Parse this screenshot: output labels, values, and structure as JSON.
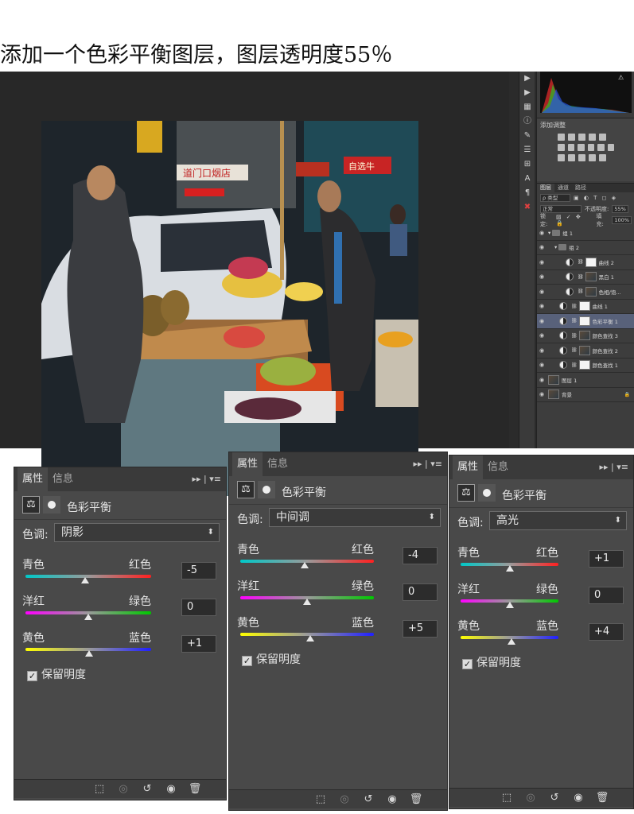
{
  "caption": "添加一个色彩平衡图层，图层透明度55％",
  "toolbar": {
    "buttons": [
      "triangle-right-icon",
      "play-icon",
      "swatch-icon",
      "info-icon",
      "brush-icon",
      "sliders-icon",
      "type-icon",
      "paragraph-icon",
      "close-icon"
    ]
  },
  "photo": {
    "signs": [
      "自选牛",
      "道门口烟店"
    ]
  },
  "adjustments_panel": {
    "label": "添加调整"
  },
  "layers_panel": {
    "tabs": [
      "图层",
      "通道",
      "路径"
    ],
    "kind_filter": "ρ 类型",
    "blend_mode": "正常",
    "opacity_label": "不透明度:",
    "opacity_value": "55%",
    "lock_label": "锁定:",
    "fill_label": "填充:",
    "fill_value": "100%",
    "layers": [
      {
        "name": "组 1",
        "type": "group"
      },
      {
        "name": "组 2",
        "type": "group"
      },
      {
        "name": "曲线 2",
        "type": "adj-white"
      },
      {
        "name": "黑白 1",
        "type": "adj-img"
      },
      {
        "name": "色相/饱... ",
        "type": "adj-img"
      },
      {
        "name": "曲线 1",
        "type": "adj-white"
      },
      {
        "name": "色彩平衡 1",
        "type": "adj-white",
        "selected": true
      },
      {
        "name": "颜色查找 3",
        "type": "adj-img"
      },
      {
        "name": "颜色查找 2",
        "type": "adj-img"
      },
      {
        "name": "颜色查找 1",
        "type": "adj-white"
      },
      {
        "name": "图层 1",
        "type": "pixel"
      },
      {
        "name": "背景",
        "type": "pixel"
      }
    ]
  },
  "properties_panels": [
    {
      "tabs": [
        "属性",
        "信息"
      ],
      "title": "色彩平衡",
      "tone_label": "色调:",
      "tone_value": "阴影",
      "sliders": [
        {
          "left": "青色",
          "right": "红色",
          "value": "-5",
          "num": -5
        },
        {
          "left": "洋红",
          "right": "绿色",
          "value": "0",
          "num": 0
        },
        {
          "left": "黄色",
          "right": "蓝色",
          "value": "+1",
          "num": 1
        }
      ],
      "preserve_label": "保留明度",
      "preserve_checked": true
    },
    {
      "tabs": [
        "属性",
        "信息"
      ],
      "title": "色彩平衡",
      "tone_label": "色调:",
      "tone_value": "中间调",
      "sliders": [
        {
          "left": "青色",
          "right": "红色",
          "value": "-4",
          "num": -4
        },
        {
          "left": "洋红",
          "right": "绿色",
          "value": "0",
          "num": 0
        },
        {
          "left": "黄色",
          "right": "蓝色",
          "value": "+5",
          "num": 5
        }
      ],
      "preserve_label": "保留明度",
      "preserve_checked": true
    },
    {
      "tabs": [
        "属性",
        "信息"
      ],
      "title": "色彩平衡",
      "tone_label": "色调:",
      "tone_value": "高光",
      "sliders": [
        {
          "left": "青色",
          "right": "红色",
          "value": "+1",
          "num": 1
        },
        {
          "left": "洋红",
          "right": "绿色",
          "value": "0",
          "num": 0
        },
        {
          "left": "黄色",
          "right": "蓝色",
          "value": "+4",
          "num": 4
        }
      ],
      "preserve_label": "保留明度",
      "preserve_checked": true
    }
  ]
}
